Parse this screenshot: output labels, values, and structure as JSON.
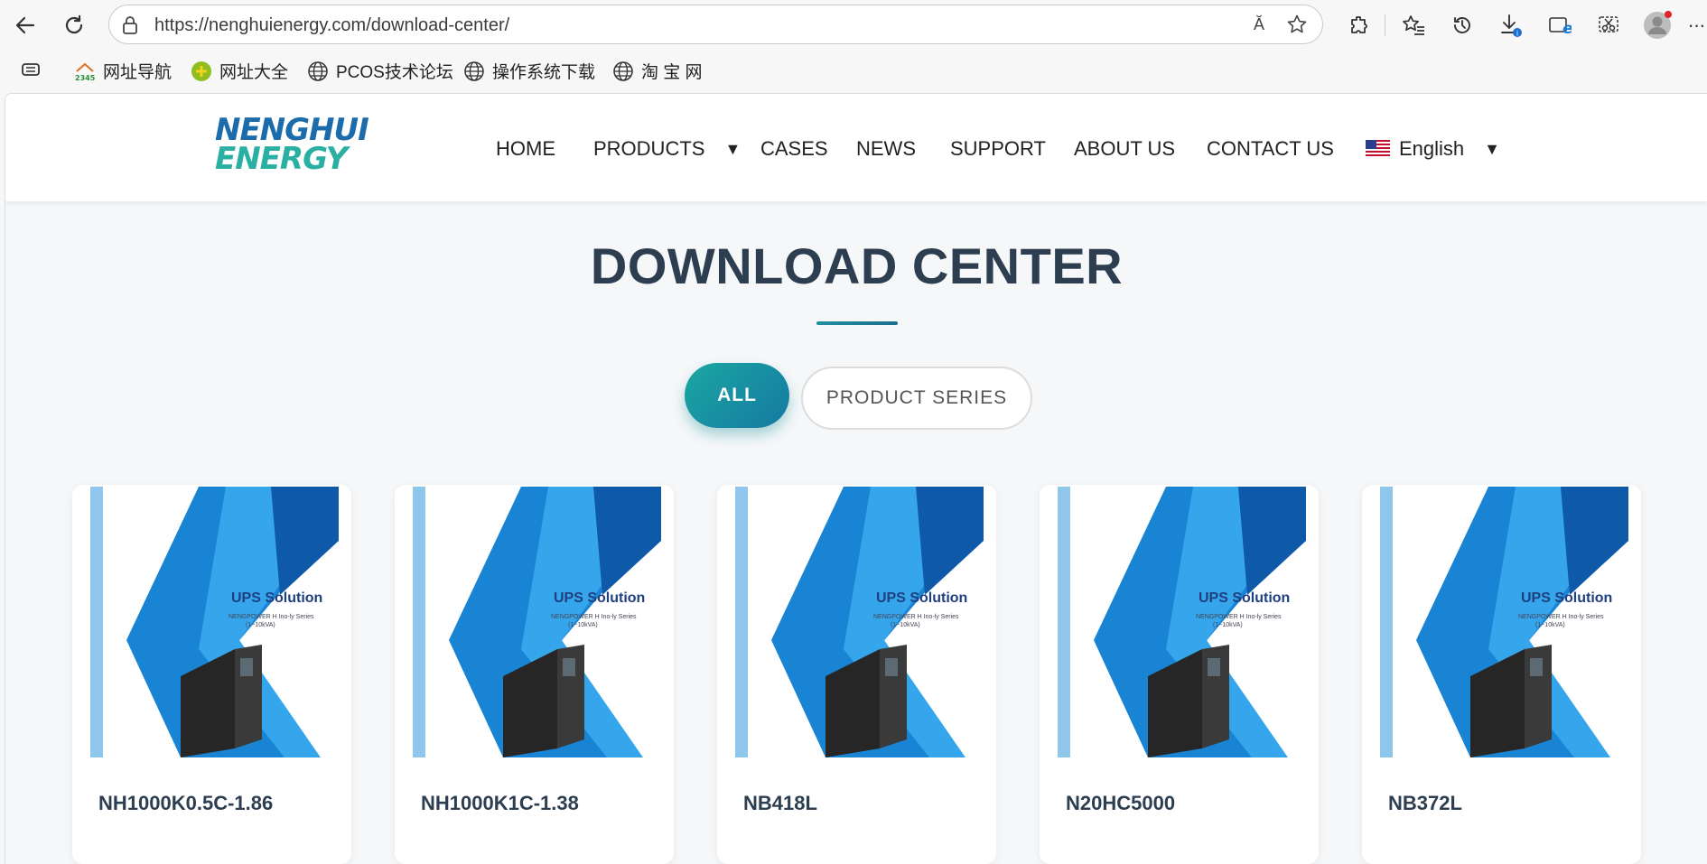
{
  "browser": {
    "url": "https://nenghuienergy.com/download-center/",
    "read_aloud_glyph": "Ă",
    "bookmarks": [
      {
        "label": "网址导航",
        "icon": "2345-icon"
      },
      {
        "label": "网址大全",
        "icon": "plus-circle-icon"
      },
      {
        "label": "PCOS技术论坛",
        "icon": "globe-icon"
      },
      {
        "label": "操作系统下载",
        "icon": "globe-icon"
      },
      {
        "label": "淘 宝 网",
        "icon": "globe-icon"
      }
    ]
  },
  "site": {
    "logo_line1": "NENGHUI",
    "logo_line2": "ENERGY",
    "nav": {
      "home": "HOME",
      "products": "PRODUCTS",
      "cases": "CASES",
      "news": "NEWS",
      "support": "SUPPORT",
      "about": "ABOUT US",
      "contact": "CONTACT US",
      "language": "English",
      "caret": "▼"
    },
    "page_title": "DOWNLOAD CENTER",
    "filters": {
      "all": "ALL",
      "series": "PRODUCT SERIES"
    },
    "brochure": {
      "heading": "UPS Solution",
      "sub1": "NENGPOWER H Ino-ly Series",
      "sub2": "(1~10kVA)"
    },
    "cards": [
      {
        "name": "NH1000K0.5C-1.86"
      },
      {
        "name": "NH1000K1C-1.38"
      },
      {
        "name": "NB418L"
      },
      {
        "name": "N20HC5000"
      },
      {
        "name": "NB372L"
      }
    ]
  },
  "colors": {
    "accent": "#1a8fa2",
    "title": "#2c3e50",
    "logo_blue": "#1c6cab",
    "logo_teal": "#2ab0a2"
  }
}
